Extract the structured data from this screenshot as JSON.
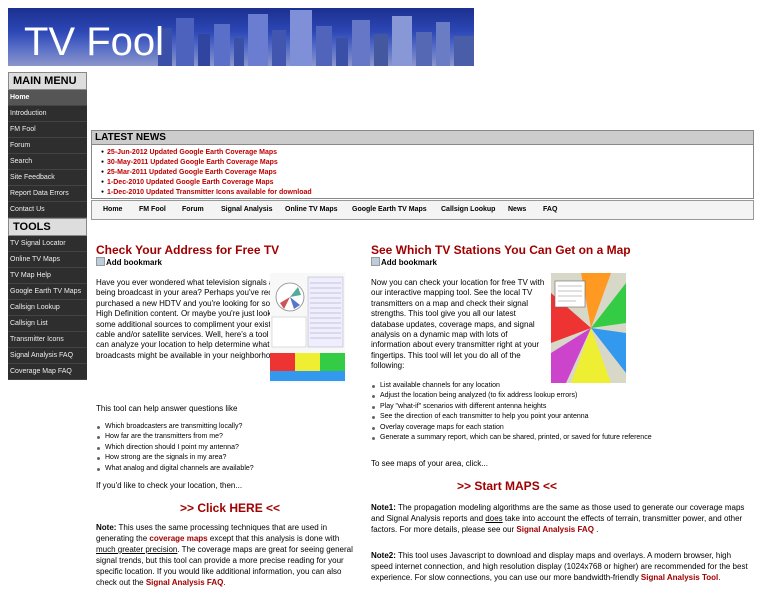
{
  "site": {
    "logo": "TV Fool"
  },
  "sidebar": {
    "main_menu_title": "MAIN MENU",
    "main_items": [
      "Home",
      "Introduction",
      "FM Fool",
      "Forum",
      "Search",
      "Site Feedback",
      "Report Data Errors",
      "Contact Us"
    ],
    "tools_title": "TOOLS",
    "tool_items": [
      "TV Signal Locator",
      "Online TV Maps",
      "TV Map Help",
      "Google Earth TV Maps",
      "Callsign Lookup",
      "Callsign List",
      "Transmitter Icons",
      "Signal Analysis FAQ",
      "Coverage Map FAQ"
    ]
  },
  "news": {
    "title": "LATEST NEWS",
    "items": [
      "25-Jun-2012 Updated Google Earth Coverage Maps",
      "30-May-2011 Updated Google Earth Coverage Maps",
      "25-Mar-2011 Updated Google Earth Coverage Maps",
      "1-Dec-2010 Updated Google Earth Coverage Maps",
      "1-Dec-2010 Updated Transmitter Icons available for download"
    ]
  },
  "nav": [
    "Home",
    "FM Fool",
    "Forum",
    "Signal Analysis",
    "Online TV Maps",
    "Google Earth TV Maps",
    "Callsign Lookup",
    "News",
    "FAQ"
  ],
  "left": {
    "title": "Check Your Address for Free TV",
    "bookmark": "Add bookmark",
    "intro": "Have you ever wondered what television signals are being broadcast in your area? Perhaps you've recently purchased a new HDTV and you're looking for some High Definition content. Or maybe you're just looking for some additional sources to compliment your existing cable and/or satellite services. Well, here's a tool that can analyze your location to help determine what FREE broadcasts might be available in your neighborhood.",
    "help_intro": "This tool can help answer questions like",
    "questions": [
      "Which broadcasters are transmitting locally?",
      "How far are the transmitters from me?",
      "Which direction should I point my antenna?",
      "How strong are the signals in my area?",
      "What analog and digital channels are available?"
    ],
    "check_text": "If you'd like to check your location, then...",
    "cta": ">> Click HERE <<",
    "note_label": "Note:",
    "note_1": " This uses the same processing techniques that are used in generating the ",
    "note_link_1": "coverage maps",
    "note_2": " except that this analysis is done with ",
    "note_link_2": "much greater precision",
    "note_3": ". The coverage maps are great for seeing general signal trends, but this tool can provide a more precise reading for your specific location. If you would like additional information, you can also check out the ",
    "note_link_3": "Signal Analysis FAQ",
    "note_4": "."
  },
  "right": {
    "title": "See Which TV Stations You Can Get on a Map",
    "bookmark": "Add bookmark",
    "intro": "Now you can check your location for free TV with our interactive mapping tool. See the local TV transmitters on a map and check their signal strengths. This tool give you all our latest database updates, coverage maps, and signal analysis on a dynamic map with lots of information about every transmitter right at your fingertips. This tool will let you do all of the following:",
    "features": [
      "List available channels for any location",
      "Adjust the location being analyzed (to fix address lookup errors)",
      "Play \"what-if\" scenarios with different antenna heights",
      "See the direction of each transmitter to help you point your antenna",
      "Overlay coverage maps for each station",
      "Generate a summary report, which can be shared, printed, or saved for future reference"
    ],
    "maps_text": "To see maps of your area, click...",
    "cta": ">> Start MAPS <<",
    "note1_label": "Note1:",
    "note1_a": " The propagation modeling algorithms are the same as those used to generate our coverage maps and Signal Analysis reports and ",
    "note1_does": "does",
    "note1_b": " take into account the effects of terrain, transmitter power, and other factors. For more details, please see our ",
    "note1_link": "Signal Analysis FAQ",
    "note1_c": " .",
    "note2_label": "Note2:",
    "note2_a": " This tool uses Javascript to download and display maps and overlays. A modern browser, high speed internet connection, and high resolution display (1024x768 or higher) are recommended for the best experience. For slow connections, you can use our more bandwidth-friendly ",
    "note2_link": "Signal Analysis Tool",
    "note2_b": "."
  }
}
